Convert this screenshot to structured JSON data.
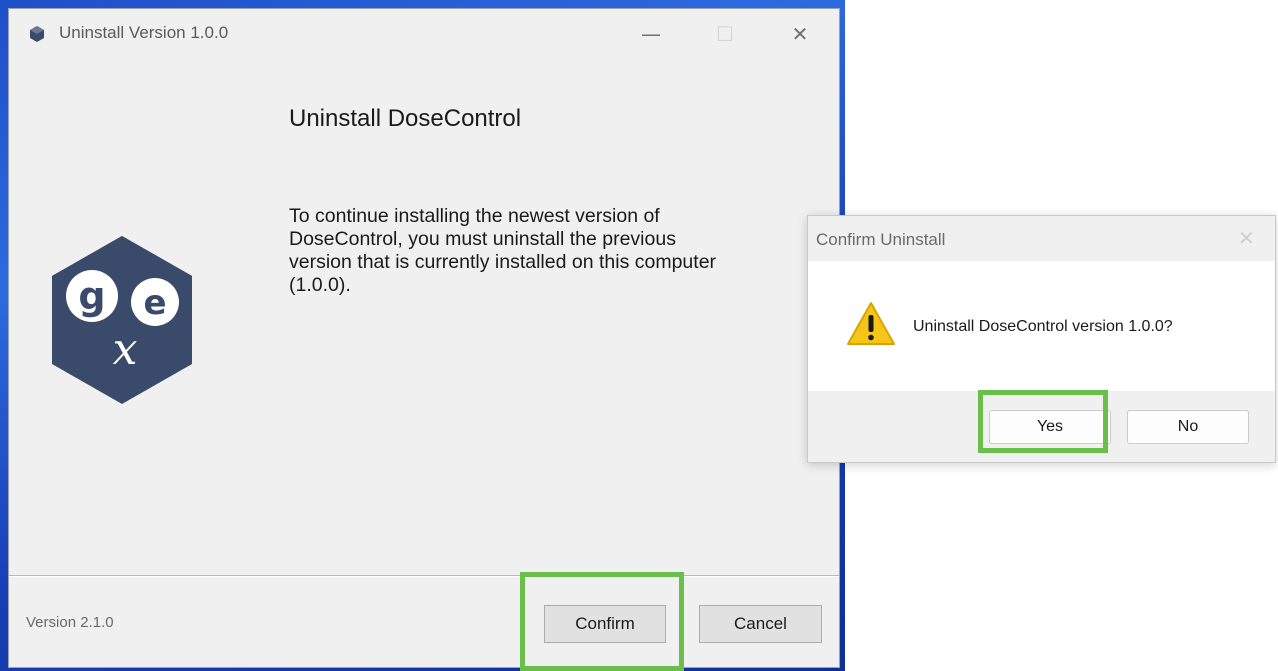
{
  "main_window": {
    "title": "Uninstall Version 1.0.0",
    "controls": {
      "minimize": "—",
      "maximize": "☐",
      "close": "✕"
    },
    "heading": "Uninstall DoseControl",
    "message_lines": [
      "To continue installing the newest version of",
      "DoseControl, you must uninstall the previous",
      "version that is currently installed on this computer",
      "(1.0.0)."
    ],
    "logo": {
      "letters": [
        "g",
        "e",
        "x"
      ],
      "color": "#3a4a6b"
    },
    "footer": {
      "version": "Version 2.1.0",
      "confirm_label": "Confirm",
      "cancel_label": "Cancel"
    }
  },
  "confirm_dialog": {
    "title": "Confirm Uninstall",
    "close": "✕",
    "icon": "warning-icon",
    "message": "Uninstall DoseControl version 1.0.0?",
    "yes_label": "Yes",
    "no_label": "No"
  },
  "colors": {
    "highlight": "#6abf4b",
    "wallpaper": "#1d4fc9",
    "warning": "#f5c518"
  }
}
